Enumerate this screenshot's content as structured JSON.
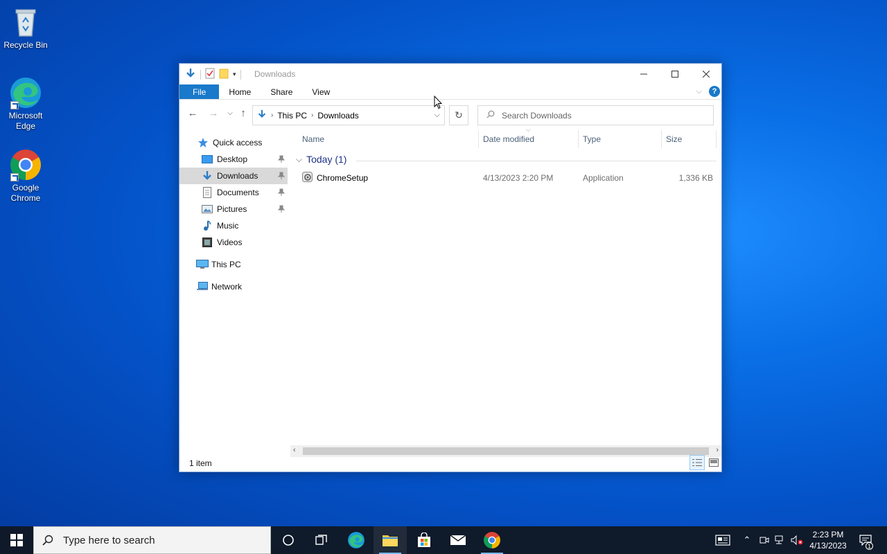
{
  "desktop": {
    "icons": [
      {
        "label_line1": "Recycle Bin",
        "label_line2": ""
      },
      {
        "label_line1": "Microsoft",
        "label_line2": "Edge"
      },
      {
        "label_line1": "Google",
        "label_line2": "Chrome"
      }
    ]
  },
  "window": {
    "title": "Downloads",
    "ribbon": {
      "tabs": [
        "File",
        "Home",
        "Share",
        "View"
      ],
      "help": "?"
    },
    "address": {
      "crumbs": [
        "This PC",
        "Downloads"
      ]
    },
    "search": {
      "placeholder": "Search Downloads"
    },
    "nav": {
      "quick_access": "Quick access",
      "items": [
        {
          "label": "Desktop",
          "pinned": true
        },
        {
          "label": "Downloads",
          "pinned": true,
          "selected": true
        },
        {
          "label": "Documents",
          "pinned": true
        },
        {
          "label": "Pictures",
          "pinned": true
        },
        {
          "label": "Music",
          "pinned": false
        },
        {
          "label": "Videos",
          "pinned": false
        }
      ],
      "this_pc": "This PC",
      "network": "Network"
    },
    "columns": [
      "Name",
      "Date modified",
      "Type",
      "Size"
    ],
    "group": {
      "label": "Today (1)"
    },
    "files": [
      {
        "name": "ChromeSetup",
        "date": "4/13/2023 2:20 PM",
        "type": "Application",
        "size": "1,336 KB"
      }
    ],
    "status": "1 item"
  },
  "taskbar": {
    "search_placeholder": "Type here to search",
    "clock_time": "2:23 PM",
    "clock_date": "4/13/2023",
    "notification_count": "1"
  },
  "colors": {
    "accent": "#1979ca",
    "selection": "#d9d9d9",
    "group_text": "#1e3287"
  }
}
